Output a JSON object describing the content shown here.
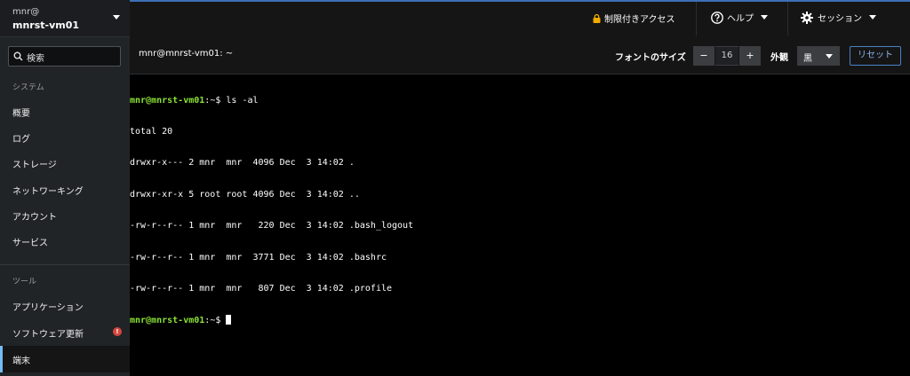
{
  "sidebar": {
    "host_user": "mnr@",
    "host_name": "mnrst-vm01",
    "search_placeholder": "検索",
    "section_system": "システム",
    "section_tools": "ツール",
    "system_items": [
      {
        "label": "概要"
      },
      {
        "label": "ログ"
      },
      {
        "label": "ストレージ"
      },
      {
        "label": "ネットワーキング"
      },
      {
        "label": "アカウント"
      },
      {
        "label": "サービス"
      }
    ],
    "tool_items": [
      {
        "label": "アプリケーション"
      },
      {
        "label": "ソフトウェア更新",
        "badge": "!"
      },
      {
        "label": "端末",
        "active": true
      }
    ]
  },
  "masthead": {
    "restricted_access": "制限付きアクセス",
    "help": "ヘルプ",
    "session": "セッション"
  },
  "terminal_header": {
    "title": "mnr@mnrst-vm01: ~",
    "font_size_label": "フォントのサイズ",
    "font_size_value": "16",
    "font_decrease": "−",
    "font_increase": "+",
    "appearance_label": "外観",
    "appearance_value": "黒",
    "reset": "リセット"
  },
  "terminal": {
    "prompt": "mnr@mnrst-vm01",
    "path_suffix": ":~$",
    "command": " ls -al",
    "output": [
      "total 20",
      "drwxr-x--- 2 mnr  mnr  4096 Dec  3 14:02 .",
      "drwxr-xr-x 5 root root 4096 Dec  3 14:02 ..",
      "-rw-r--r-- 1 mnr  mnr   220 Dec  3 14:02 .bash_logout",
      "-rw-r--r-- 1 mnr  mnr  3771 Dec  3 14:02 .bashrc",
      "-rw-r--r-- 1 mnr  mnr   807 Dec  3 14:02 .profile"
    ]
  },
  "colors": {
    "accent": "#73bcf7",
    "prompt_green": "#8ae234",
    "badge_red": "#d4473d"
  }
}
